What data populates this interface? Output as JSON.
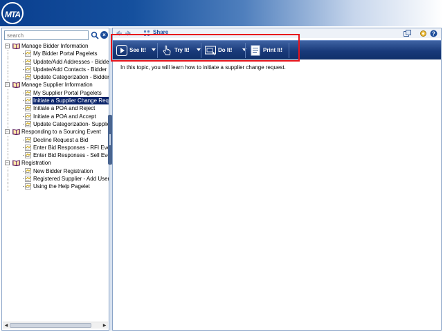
{
  "header": {
    "logo_text": "MTA",
    "brand_color": "#0a3f8f"
  },
  "sidebar": {
    "search": {
      "placeholder": "search",
      "value": ""
    },
    "tree": [
      {
        "type": "group",
        "label": "Manage Bidder Information"
      },
      {
        "type": "leaf",
        "label": "My Bidder Portal Pagelets"
      },
      {
        "type": "leaf",
        "label": "Update/Add Addresses - Bidder"
      },
      {
        "type": "leaf",
        "label": "Update/Add Contacts - Bidder"
      },
      {
        "type": "leaf",
        "label": "Update Categorization - Bidder"
      },
      {
        "type": "group",
        "label": "Manage Supplier Information"
      },
      {
        "type": "leaf",
        "label": "My Supplier Portal Pagelets"
      },
      {
        "type": "leaf",
        "label": "Initiate a Supplier Change Request",
        "selected": true
      },
      {
        "type": "leaf",
        "label": "Initiate a POA and Reject"
      },
      {
        "type": "leaf",
        "label": "Initiate a POA and Accept"
      },
      {
        "type": "leaf",
        "label": "Update Categorization- Supplier"
      },
      {
        "type": "group",
        "label": "Responding to a Sourcing Event"
      },
      {
        "type": "leaf",
        "label": "Decline Request a Bid"
      },
      {
        "type": "leaf",
        "label": "Enter Bid Responses - RFI Event"
      },
      {
        "type": "leaf",
        "label": "Enter Bid Responses - Sell Event"
      },
      {
        "type": "group",
        "label": "Registration"
      },
      {
        "type": "leaf",
        "label": "New Bidder Registration"
      },
      {
        "type": "leaf",
        "label": "Registered Supplier - Add User Account"
      },
      {
        "type": "leaf",
        "label": "Using the Help Pagelet"
      }
    ]
  },
  "topbar": {
    "share_label": "Share"
  },
  "toolbar": {
    "see_it": "See It!",
    "try_it": "Try It!",
    "do_it": "Do It!",
    "print_it": "Print It!"
  },
  "content": {
    "intro": "In this topic, you will learn how to initiate a supplier change request."
  },
  "colors": {
    "highlight": "#e8141b",
    "toolbar": "#193a7a",
    "selection": "#0a246a"
  }
}
